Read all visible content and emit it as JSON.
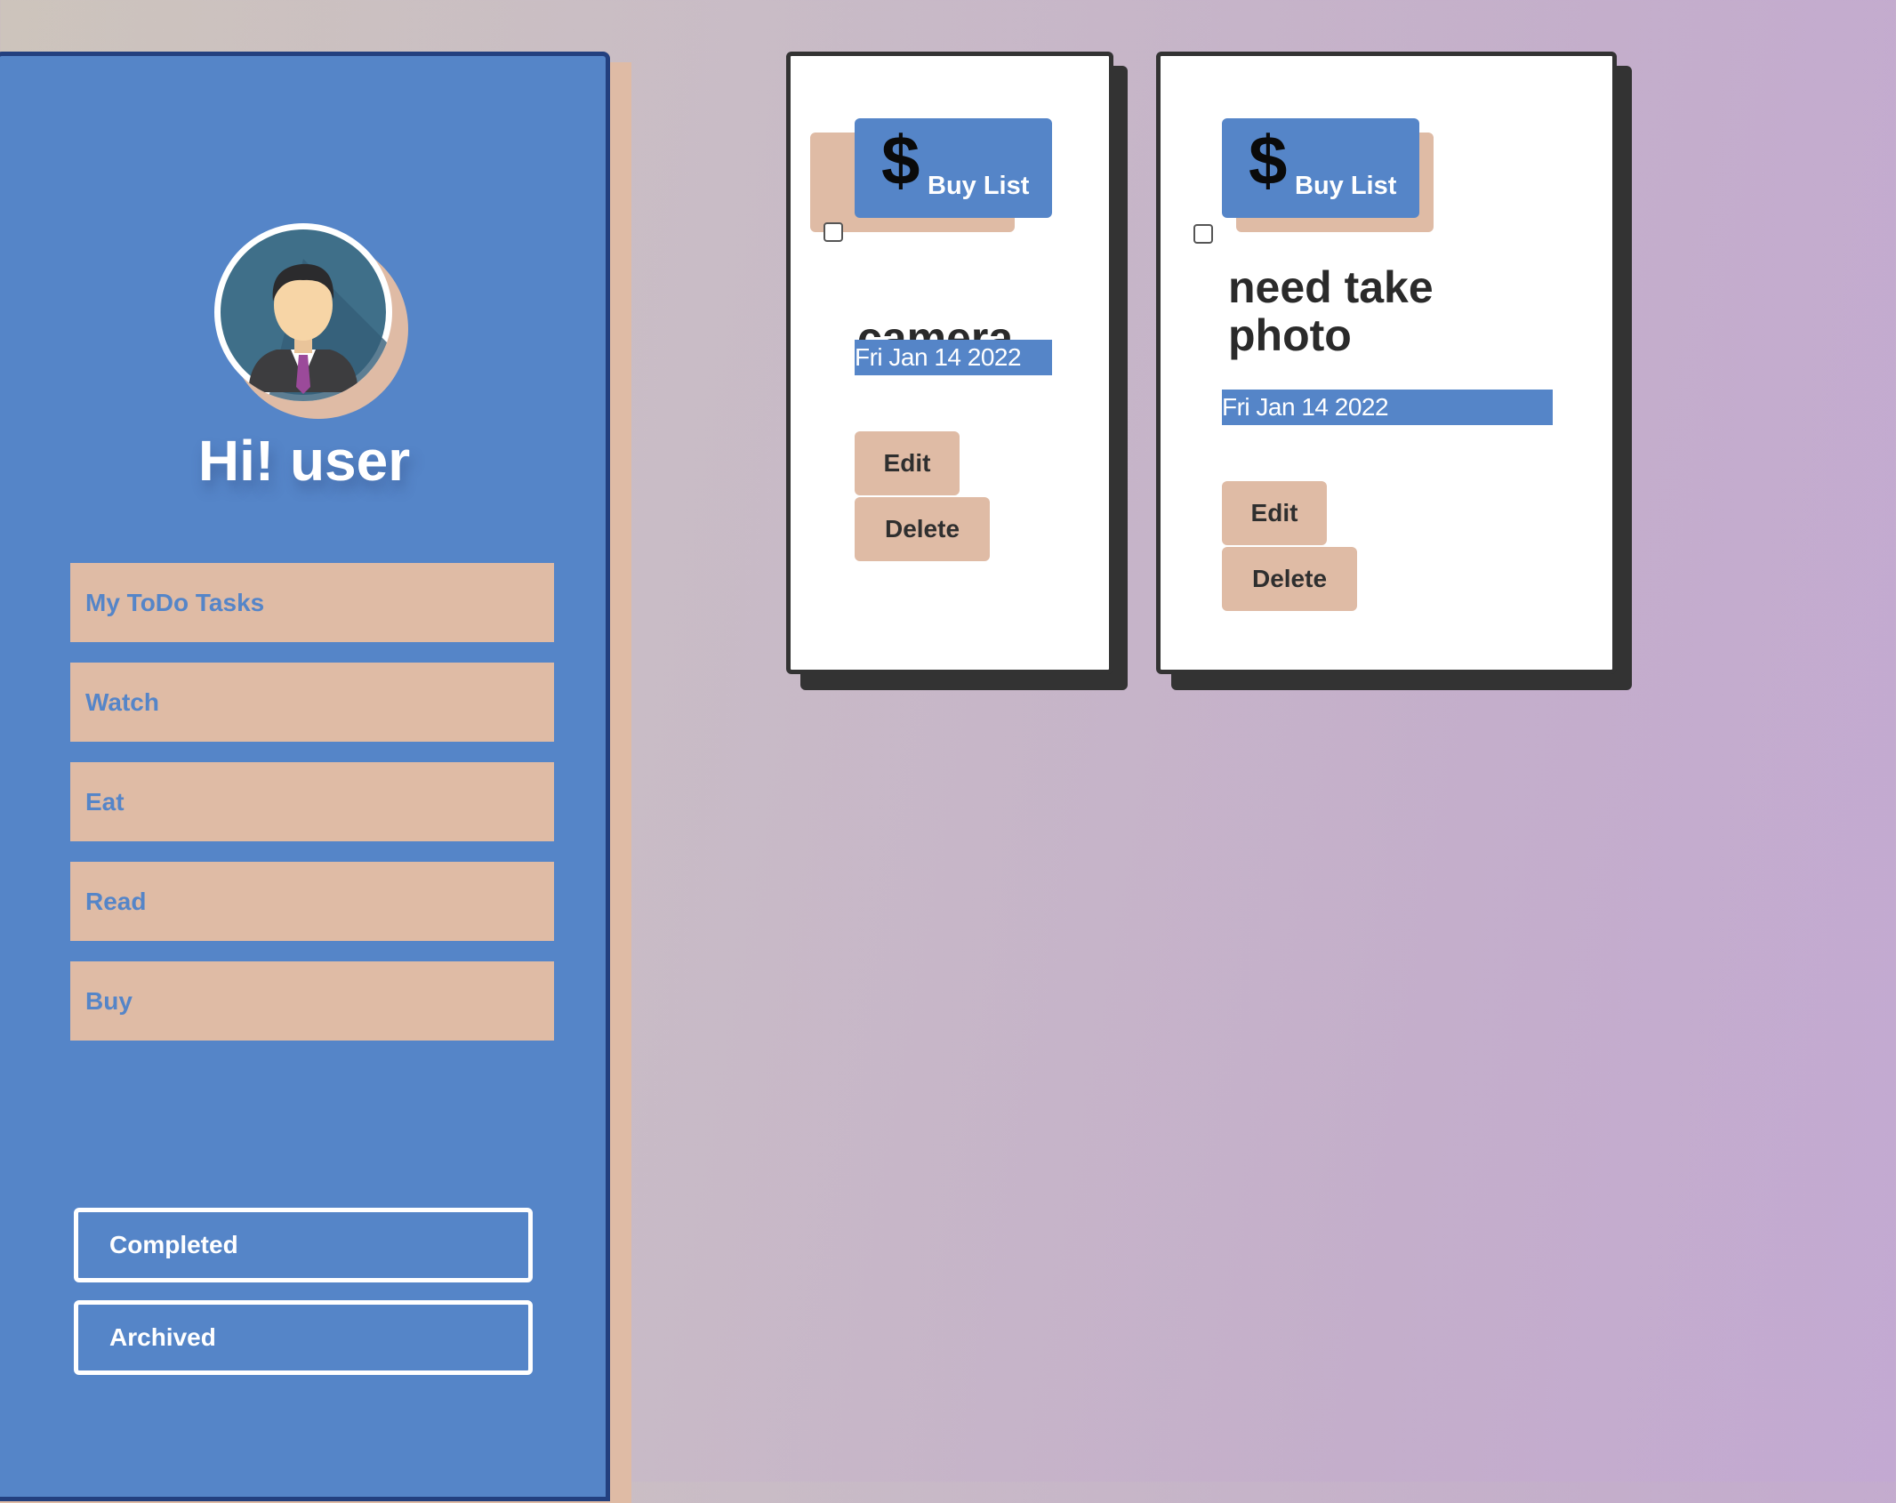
{
  "sidebar": {
    "greeting": "Hi! user",
    "nav_items": [
      {
        "label": "My ToDo Tasks"
      },
      {
        "label": "Watch"
      },
      {
        "label": "Eat"
      },
      {
        "label": "Read"
      },
      {
        "label": "Buy"
      }
    ],
    "completed_label": "Completed",
    "archived_label": "Archived"
  },
  "tasks": [
    {
      "category_icon": "dollar-icon",
      "category_symbol": "$",
      "category": "Buy List",
      "title": "camera",
      "date": "Fri Jan 14 2022",
      "checked": false,
      "edit_label": "Edit",
      "delete_label": "Delete"
    },
    {
      "category_icon": "dollar-icon",
      "category_symbol": "$",
      "category": "Buy List",
      "title": "need take photo",
      "date": "Fri Jan 14 2022",
      "checked": false,
      "edit_label": "Edit",
      "delete_label": "Delete"
    }
  ],
  "colors": {
    "sidebar_blue": "#5585c8",
    "sidebar_border": "#23407f",
    "accent_peach": "#dfbba5",
    "card_border": "#333333"
  }
}
